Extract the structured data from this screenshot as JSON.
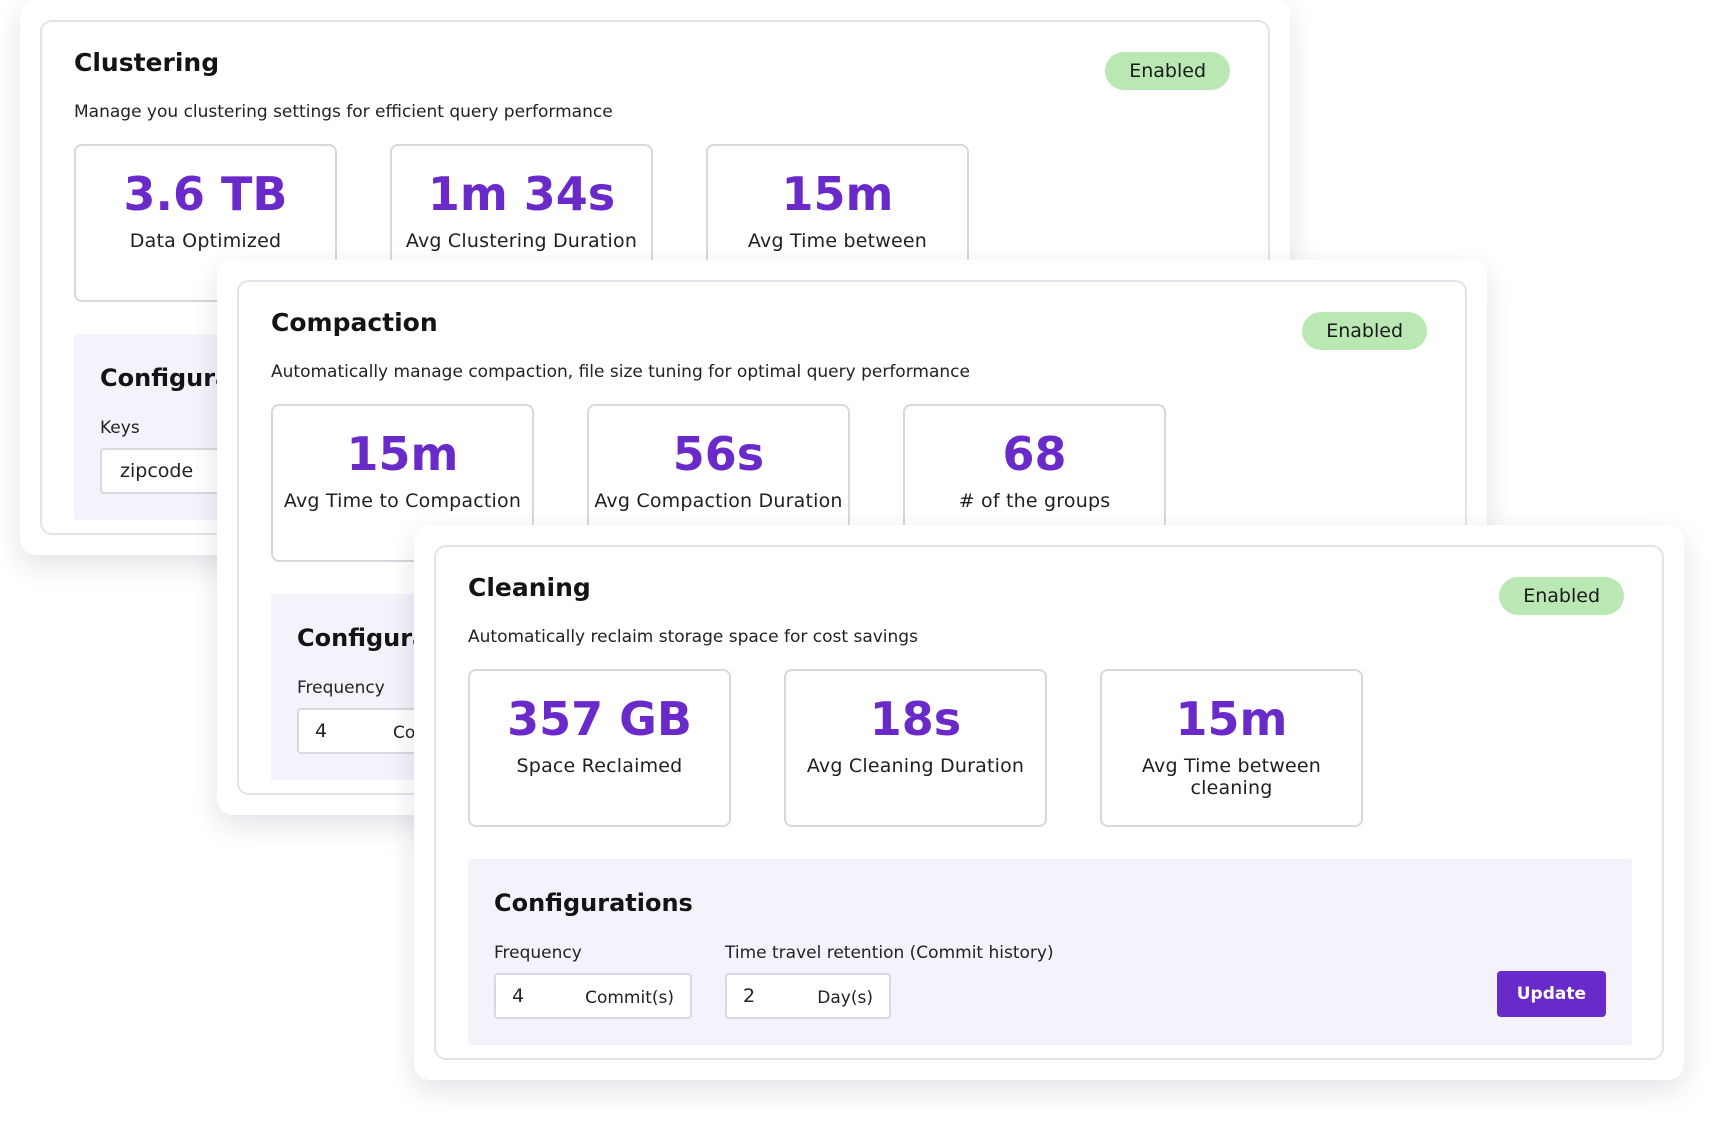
{
  "clustering": {
    "title": "Clustering",
    "subtitle": "Manage you clustering settings for efficient query performance",
    "status": "Enabled",
    "stats": [
      {
        "value": "3.6 TB",
        "label": "Data Optimized"
      },
      {
        "value": "1m 34s",
        "label": "Avg Clustering Duration"
      },
      {
        "value": "15m",
        "label": "Avg Time between"
      }
    ],
    "config": {
      "title": "Configurat",
      "keys_label": "Keys",
      "keys_value": "zipcode"
    }
  },
  "compaction": {
    "title": "Compaction",
    "subtitle": "Automatically manage compaction, file size tuning for optimal query performance",
    "status": "Enabled",
    "stats": [
      {
        "value": "15m",
        "label": "Avg Time to Compaction"
      },
      {
        "value": "56s",
        "label": "Avg Compaction Duration"
      },
      {
        "value": "68",
        "label": "# of the groups"
      }
    ],
    "config": {
      "title": "Configurati",
      "frequency_label": "Frequency",
      "frequency_value": "4",
      "frequency_unit": "Cor"
    }
  },
  "cleaning": {
    "title": "Cleaning",
    "subtitle": "Automatically reclaim storage space for cost savings",
    "status": "Enabled",
    "stats": [
      {
        "value": "357 GB",
        "label": "Space Reclaimed"
      },
      {
        "value": "18s",
        "label": "Avg Cleaning Duration"
      },
      {
        "value": "15m",
        "label": "Avg Time between cleaning"
      }
    ],
    "config": {
      "title": "Configurations",
      "frequency_label": "Frequency",
      "frequency_value": "4",
      "frequency_unit": "Commit(s)",
      "retention_label": "Time travel retention (Commit history)",
      "retention_value": "2",
      "retention_unit": "Day(s)",
      "update_label": "Update"
    }
  },
  "colors": {
    "accent": "#6a2ac9",
    "badge_bg": "#b9e8b3",
    "config_bg": "#f4f2fa"
  }
}
